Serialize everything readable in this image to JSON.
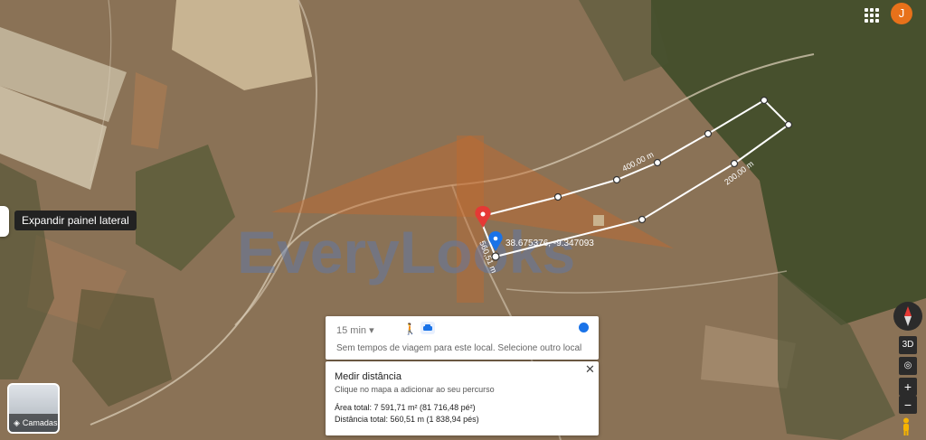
{
  "map": {
    "watermark": "EveryLooks",
    "coords_label": "38.675376, -9.347093",
    "segment_labels": [
      "400,00 m",
      "200,00 m",
      "560,51 m"
    ],
    "marker_color": "#e53935",
    "pin_color": "#1a73e8"
  },
  "header": {
    "apps_icon": "apps-grid-icon",
    "avatar_letter": "J",
    "avatar_color": "#e8711a"
  },
  "sidebar": {
    "expand_tooltip": "Expandir painel lateral"
  },
  "layers": {
    "label": "Camadas"
  },
  "travel": {
    "time_value": "15 min",
    "message": "Sem tempos de viagem para este local. Selecione outro local"
  },
  "measure": {
    "title": "Medir distância",
    "hint": "Clique no mapa a adicionar ao seu percurso",
    "area": "Área total: 7 591,71 m² (81 716,48 pé²)",
    "distance": "Distância total: 560,51 m (1 838,94 pés)"
  },
  "controls": {
    "view3d": "3D",
    "zoom_in": "+",
    "zoom_out": "−"
  }
}
